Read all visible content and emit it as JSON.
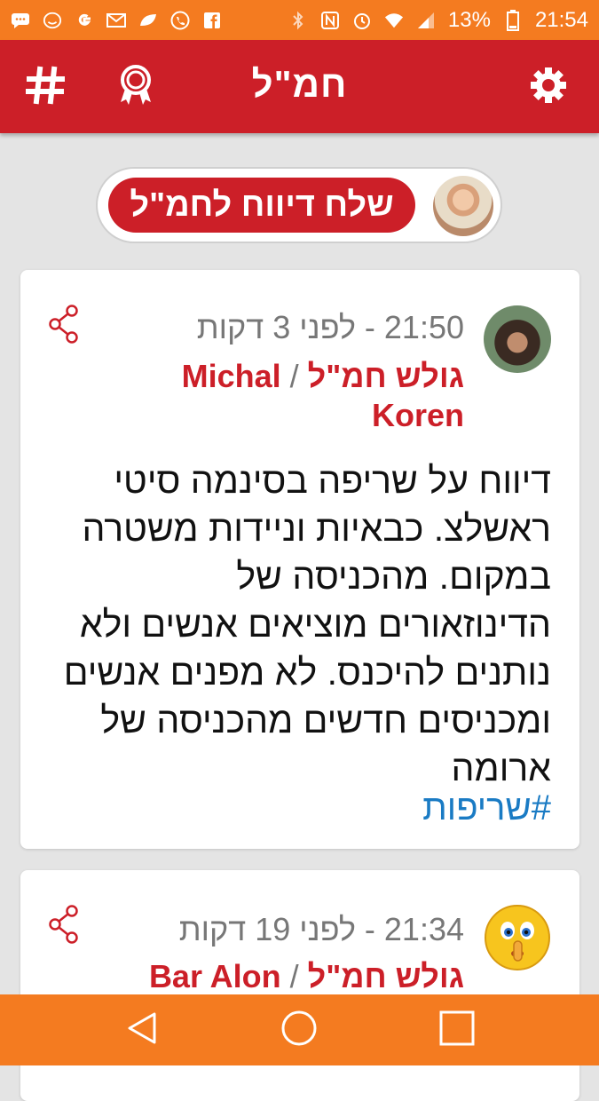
{
  "status_bar": {
    "battery_percent": "13%",
    "time": "21:54",
    "left_icons": [
      "chat-icon",
      "emoji-icon",
      "google-icon",
      "gmail-icon",
      "leaf-icon",
      "phone-icon",
      "facebook-icon"
    ],
    "right_icons": [
      "bluetooth-icon",
      "nfc-icon",
      "alarm-icon",
      "wifi-icon",
      "signal-icon",
      "battery-icon"
    ]
  },
  "app_bar": {
    "title": "חמ\"ל",
    "hash_icon": "hash-icon",
    "award_icon": "award-icon",
    "settings_icon": "gear-icon",
    "color": "#cc1f28"
  },
  "report": {
    "button_label": "שלח דיווח לחמ\"ל"
  },
  "posts": [
    {
      "time": "21:50 - לפני 3 דקות",
      "author": "Michal Koren",
      "separator": "/",
      "role": "גולש חמ\"ל",
      "text": "דיווח על שריפה בסינמה סיטי ראשלצ. כבאיות וניידות משטרה במקום. מהכניסה של הדינוזאורים מוציאים אנשים ולא נותנים להיכנס. לא מפנים אנשים ומכניסים חדשים מהכניסה של ארומה",
      "hashtag": "#שריפות"
    },
    {
      "time": "21:34 - לפני 19 דקות",
      "author": "Bar Alon",
      "separator": "/",
      "role": "גולש חמ\"ל"
    }
  ],
  "nav_bar": {
    "icons": [
      "back-icon",
      "home-icon",
      "recent-apps-icon"
    ]
  }
}
